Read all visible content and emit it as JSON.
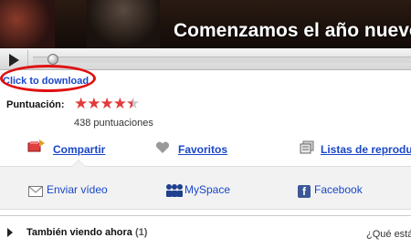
{
  "video": {
    "caption": "Comenzamos el año nuevo",
    "progress_fraction": 0.0
  },
  "download": {
    "label": "Click to download",
    "highlight_color": "#e01010"
  },
  "rating": {
    "label": "Puntuación:",
    "stars": 4.5,
    "max_stars": 5,
    "count_text": "438 puntuaciones",
    "star_color": "#e23b3b"
  },
  "actions": {
    "share": {
      "label": "Compartir",
      "icon": "share-icon"
    },
    "favorites": {
      "label": "Favoritos",
      "icon": "heart-icon"
    },
    "playlists": {
      "label": "Listas de reprodu",
      "icon": "playlist-icon"
    }
  },
  "share_links": {
    "email": {
      "label": "Enviar vídeo",
      "icon": "mail-icon"
    },
    "myspace": {
      "label": "MySpace",
      "icon": "myspace-icon"
    },
    "facebook": {
      "label": "Facebook",
      "icon": "facebook-icon",
      "glyph": "f"
    }
  },
  "also_watching": {
    "title": "También viendo ahora",
    "count": "(1)",
    "question": "¿Qué está"
  },
  "colors": {
    "link": "#1a47c9",
    "accent": "#e01010"
  }
}
